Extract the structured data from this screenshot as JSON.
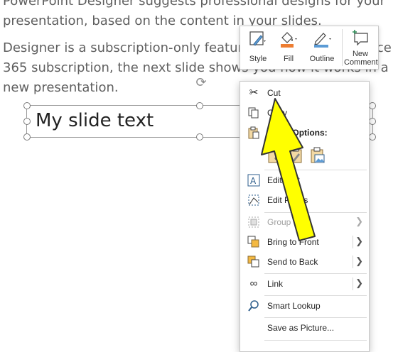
{
  "slide": {
    "paragraph1": "PowerPoint Designer suggests professional designs for your presentation, based on the content in your slides.",
    "paragraph2": "Designer is a subscription-only feature. If you have an Office 365 subscription, the next slide shows you how it works in a new presentation.",
    "textbox_text": "My slide text"
  },
  "mini_toolbar": {
    "style_label": "Style",
    "fill_label": "Fill",
    "outline_label": "Outline",
    "new_comment_label": "New\nComment",
    "fill_color": "#ed7d31",
    "outline_color": "#5b9bd5"
  },
  "context_menu": {
    "cut": "Cut",
    "copy": "Copy",
    "paste_options": "Paste Options:",
    "edit_text": "Edit Text",
    "edit_points": "Edit Points",
    "group": "Group",
    "bring_to_front": "Bring to Front",
    "send_to_back": "Send to Back",
    "link": "Link",
    "smart_lookup": "Smart Lookup",
    "save_as_picture": "Save as Picture..."
  },
  "annotation": {
    "arrow_color": "#ffff00",
    "arrow_outline": "#333333"
  }
}
